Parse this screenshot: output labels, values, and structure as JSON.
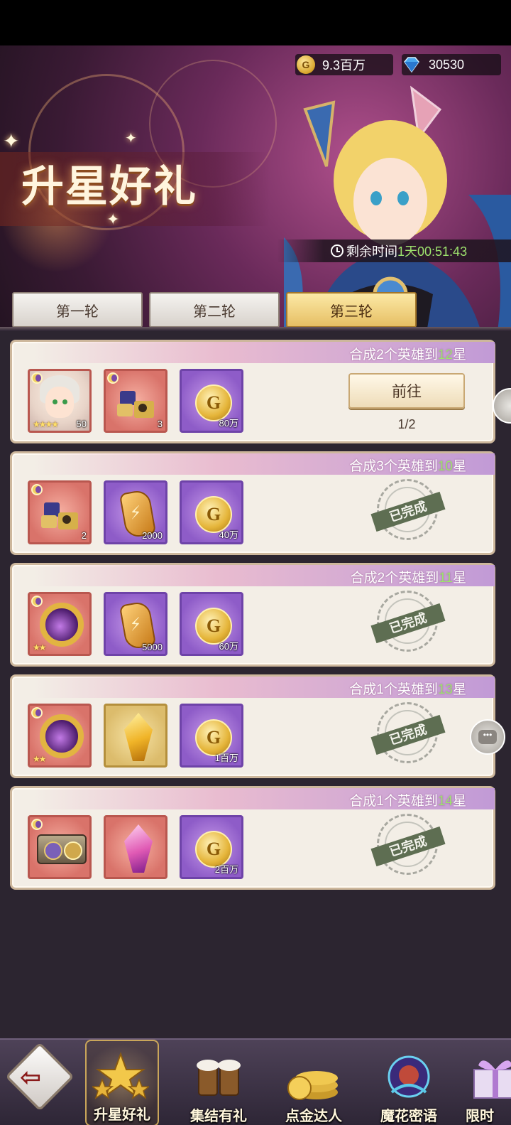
{
  "currency": {
    "coins": "9.3百万",
    "coin_icon": "G",
    "gems": "30530"
  },
  "banner": {
    "title": "升星好礼",
    "timer_label": "剩余时间",
    "timer_value": "1天00:51:43"
  },
  "tabs": [
    {
      "label": "第一轮",
      "active": false
    },
    {
      "label": "第二轮",
      "active": false
    },
    {
      "label": "第三轮",
      "active": true
    }
  ],
  "tasks": [
    {
      "desc_prefix": "合成2个英雄到",
      "goal": "12",
      "desc_suffix": "星",
      "rewards": [
        {
          "icon": "hero-portrait-icon",
          "qty": "50",
          "stars": "★★★★"
        },
        {
          "icon": "puzzle-fragment-icon",
          "qty": "3"
        },
        {
          "icon": "gold-coin-icon",
          "qty": "80万"
        }
      ],
      "status": "in-progress",
      "action_label": "前往",
      "progress": "1/2"
    },
    {
      "desc_prefix": "合成3个英雄到",
      "goal": "10",
      "desc_suffix": "星",
      "rewards": [
        {
          "icon": "puzzle-fragment-icon",
          "qty": "2"
        },
        {
          "icon": "gold-rune-icon",
          "qty": "2000"
        },
        {
          "icon": "gold-coin-icon",
          "qty": "40万"
        }
      ],
      "status": "completed",
      "done_label": "已完成"
    },
    {
      "desc_prefix": "合成2个英雄到",
      "goal": "11",
      "desc_suffix": "星",
      "rewards": [
        {
          "icon": "gold-ring-icon",
          "qty": "",
          "stars": "★★"
        },
        {
          "icon": "gold-rune-icon",
          "qty": "5000"
        },
        {
          "icon": "gold-coin-icon",
          "qty": "60万"
        }
      ],
      "status": "completed",
      "done_label": "已完成"
    },
    {
      "desc_prefix": "合成1个英雄到",
      "goal": "13",
      "desc_suffix": "星",
      "rewards": [
        {
          "icon": "gold-ring-icon",
          "qty": "",
          "stars": "★★"
        },
        {
          "icon": "gold-crystal-icon",
          "qty": ""
        },
        {
          "icon": "gold-coin-icon",
          "qty": "1百万"
        }
      ],
      "status": "completed",
      "done_label": "已完成"
    },
    {
      "desc_prefix": "合成1个英雄到",
      "goal": "14",
      "desc_suffix": "星",
      "rewards": [
        {
          "icon": "treasure-box-icon",
          "qty": ""
        },
        {
          "icon": "pink-crystal-icon",
          "qty": ""
        },
        {
          "icon": "gold-coin-icon",
          "qty": "2百万"
        }
      ],
      "status": "completed",
      "done_label": "已完成"
    }
  ],
  "bottom_nav": [
    {
      "label": "",
      "icon": "back-arrow-icon"
    },
    {
      "label": "升星好礼",
      "icon": "stars-icon",
      "active": true
    },
    {
      "label": "集结有礼",
      "icon": "beer-mugs-icon"
    },
    {
      "label": "点金达人",
      "icon": "gold-coins-stack-icon"
    },
    {
      "label": "魔花密语",
      "icon": "magic-flower-icon"
    },
    {
      "label": "限时",
      "icon": "gift-icon"
    }
  ],
  "colors": {
    "goal_green": "#9ee36e",
    "card_bg": "#f3eee6",
    "active_tab": "#e6bf64",
    "page_bg": "#2c2530"
  }
}
